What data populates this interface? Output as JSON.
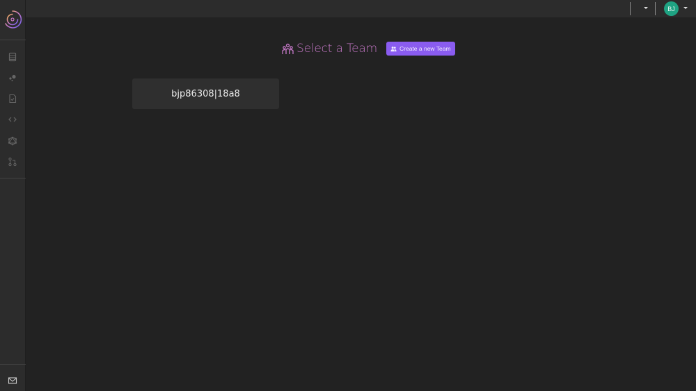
{
  "sidebar": {
    "logo": "app-logo",
    "items": [
      {
        "icon": "list-icon",
        "label": "Data"
      },
      {
        "icon": "clusters-icon",
        "label": "Clusters"
      },
      {
        "icon": "file-check-icon",
        "label": "Tests"
      },
      {
        "icon": "code-icon",
        "label": "Code"
      },
      {
        "icon": "graphql-icon",
        "label": "GraphQL"
      },
      {
        "icon": "git-pull-request-icon",
        "label": "Pull requests"
      }
    ],
    "footer_icon": "mail-icon"
  },
  "topbar": {
    "avatar_initials": "BJ",
    "avatar_color": "#1fa383"
  },
  "main": {
    "title": "Select a Team",
    "title_color": "#c678c8",
    "create_button_label": "Create a new Team",
    "accent_color": "#8a5cf0",
    "teams": [
      {
        "name": "bjp86308|18a8"
      }
    ]
  }
}
